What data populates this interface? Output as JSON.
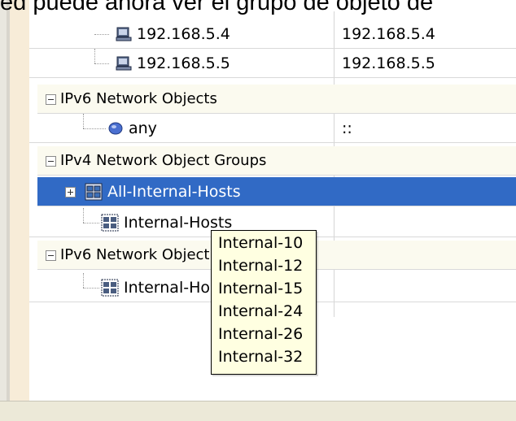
{
  "caption": "ed puede ahora ver el grupo de objeto de",
  "tree": {
    "rows": [
      {
        "label": "192.168.5.4",
        "value": "192.168.5.4"
      },
      {
        "label": "192.168.5.5",
        "value": "192.168.5.5"
      },
      {
        "label": "IPv6 Network Objects",
        "value": ""
      },
      {
        "label": "any",
        "value": "::"
      },
      {
        "label": "IPv4 Network Object Groups",
        "value": ""
      },
      {
        "label": "All-Internal-Hosts",
        "value": ""
      },
      {
        "label": "Internal-Hosts",
        "value": ""
      },
      {
        "label": "IPv6 Network Object Groups",
        "value": ""
      },
      {
        "label": "Internal-Hosts",
        "value": ""
      }
    ]
  },
  "tooltip": {
    "items": [
      "Internal-10",
      "Internal-12",
      "Internal-15",
      "Internal-24",
      "Internal-26",
      "Internal-32"
    ]
  },
  "colors": {
    "selection": "#316ac5",
    "group_row": "#fbfaef",
    "tooltip_bg": "#ffffe1",
    "left_column": "#f7ecd8"
  },
  "icons": {
    "host": "network-host-icon",
    "any": "globe-icon",
    "group": "network-group-icon",
    "group_selected": "network-group-selected-icon"
  }
}
